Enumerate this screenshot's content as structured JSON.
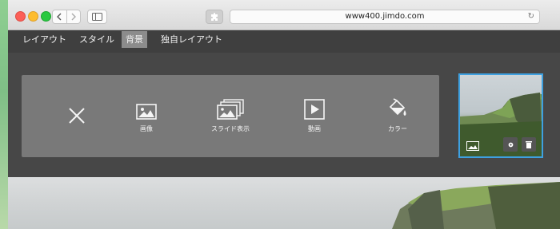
{
  "browser": {
    "url": "www400.jimdo.com",
    "icons": [
      "back-icon",
      "forward-icon",
      "sidebar-icon",
      "extension-icon",
      "reload-icon"
    ]
  },
  "menu": {
    "tabs": [
      {
        "label": "レイアウト",
        "active": false
      },
      {
        "label": "スタイル",
        "active": false
      },
      {
        "label": "背景",
        "active": true
      },
      {
        "label": "独自レイアウト",
        "active": false
      }
    ]
  },
  "background_panel": {
    "options": [
      {
        "label": "画像",
        "icon": "image-icon"
      },
      {
        "label": "スライド表示",
        "icon": "slideshow-icon"
      },
      {
        "label": "動画",
        "icon": "video-icon"
      },
      {
        "label": "カラー",
        "icon": "paint-bucket-icon"
      }
    ],
    "close_icon": "close-icon"
  },
  "thumbnail": {
    "icons": [
      "image-icon",
      "gear-icon",
      "trash-icon"
    ]
  },
  "colors": {
    "accent": "#3ea0e0",
    "panel": "#797979",
    "active_tab": "#8c8c8c"
  }
}
